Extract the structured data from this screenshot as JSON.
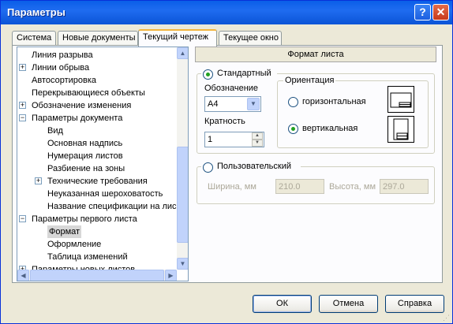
{
  "window": {
    "title": "Параметры",
    "help_glyph": "?",
    "close_glyph": "✕"
  },
  "tabs": [
    {
      "label": "Система",
      "active": false
    },
    {
      "label": "Новые документы",
      "active": false
    },
    {
      "label": "Текущий чертеж",
      "active": true
    },
    {
      "label": "Текущее окно",
      "active": false
    }
  ],
  "tree": {
    "items": [
      {
        "label": "Линия разрыва",
        "level": 0,
        "expander": ""
      },
      {
        "label": "Линии обрыва",
        "level": 0,
        "expander": "+"
      },
      {
        "label": "Автосортировка",
        "level": 0,
        "expander": ""
      },
      {
        "label": "Перекрывающиеся объекты",
        "level": 0,
        "expander": ""
      },
      {
        "label": "Обозначение изменения",
        "level": 0,
        "expander": "+"
      },
      {
        "label": "Параметры документа",
        "level": 0,
        "expander": "-"
      },
      {
        "label": "Вид",
        "level": 1,
        "expander": ""
      },
      {
        "label": "Основная надпись",
        "level": 1,
        "expander": ""
      },
      {
        "label": "Нумерация листов",
        "level": 1,
        "expander": ""
      },
      {
        "label": "Разбиение на зоны",
        "level": 1,
        "expander": ""
      },
      {
        "label": "Технические требования",
        "level": 1,
        "expander": "+"
      },
      {
        "label": "Неуказанная шероховатость",
        "level": 1,
        "expander": ""
      },
      {
        "label": "Название спецификации на лис",
        "level": 1,
        "expander": ""
      },
      {
        "label": "Параметры первого листа",
        "level": 0,
        "expander": "-"
      },
      {
        "label": "Формат",
        "level": 1,
        "expander": "",
        "selected": true
      },
      {
        "label": "Оформление",
        "level": 1,
        "expander": ""
      },
      {
        "label": "Таблица изменений",
        "level": 1,
        "expander": ""
      },
      {
        "label": "Параметры новых листов",
        "level": 0,
        "expander": "+"
      }
    ],
    "scroll_up": "▲",
    "scroll_down": "▼",
    "scroll_left": "◀",
    "scroll_right": "▶"
  },
  "format": {
    "header": "Формат листа",
    "standard_label": "Стандартный",
    "standard_selected": true,
    "designation_label": "Обозначение",
    "designation_value": "A4",
    "multiplicity_label": "Кратность",
    "multiplicity_value": "1",
    "orientation_label": "Ориентация",
    "horizontal_label": "горизонтальная",
    "vertical_label": "вертикальная",
    "orientation_selected": "vertical",
    "custom_label": "Пользовательский",
    "custom_selected": false,
    "width_label": "Ширина, мм",
    "width_value": "210.0",
    "height_label": "Высота, мм",
    "height_value": "297.0"
  },
  "buttons": {
    "ok": "ОК",
    "cancel": "Отмена",
    "help": "Справка"
  }
}
